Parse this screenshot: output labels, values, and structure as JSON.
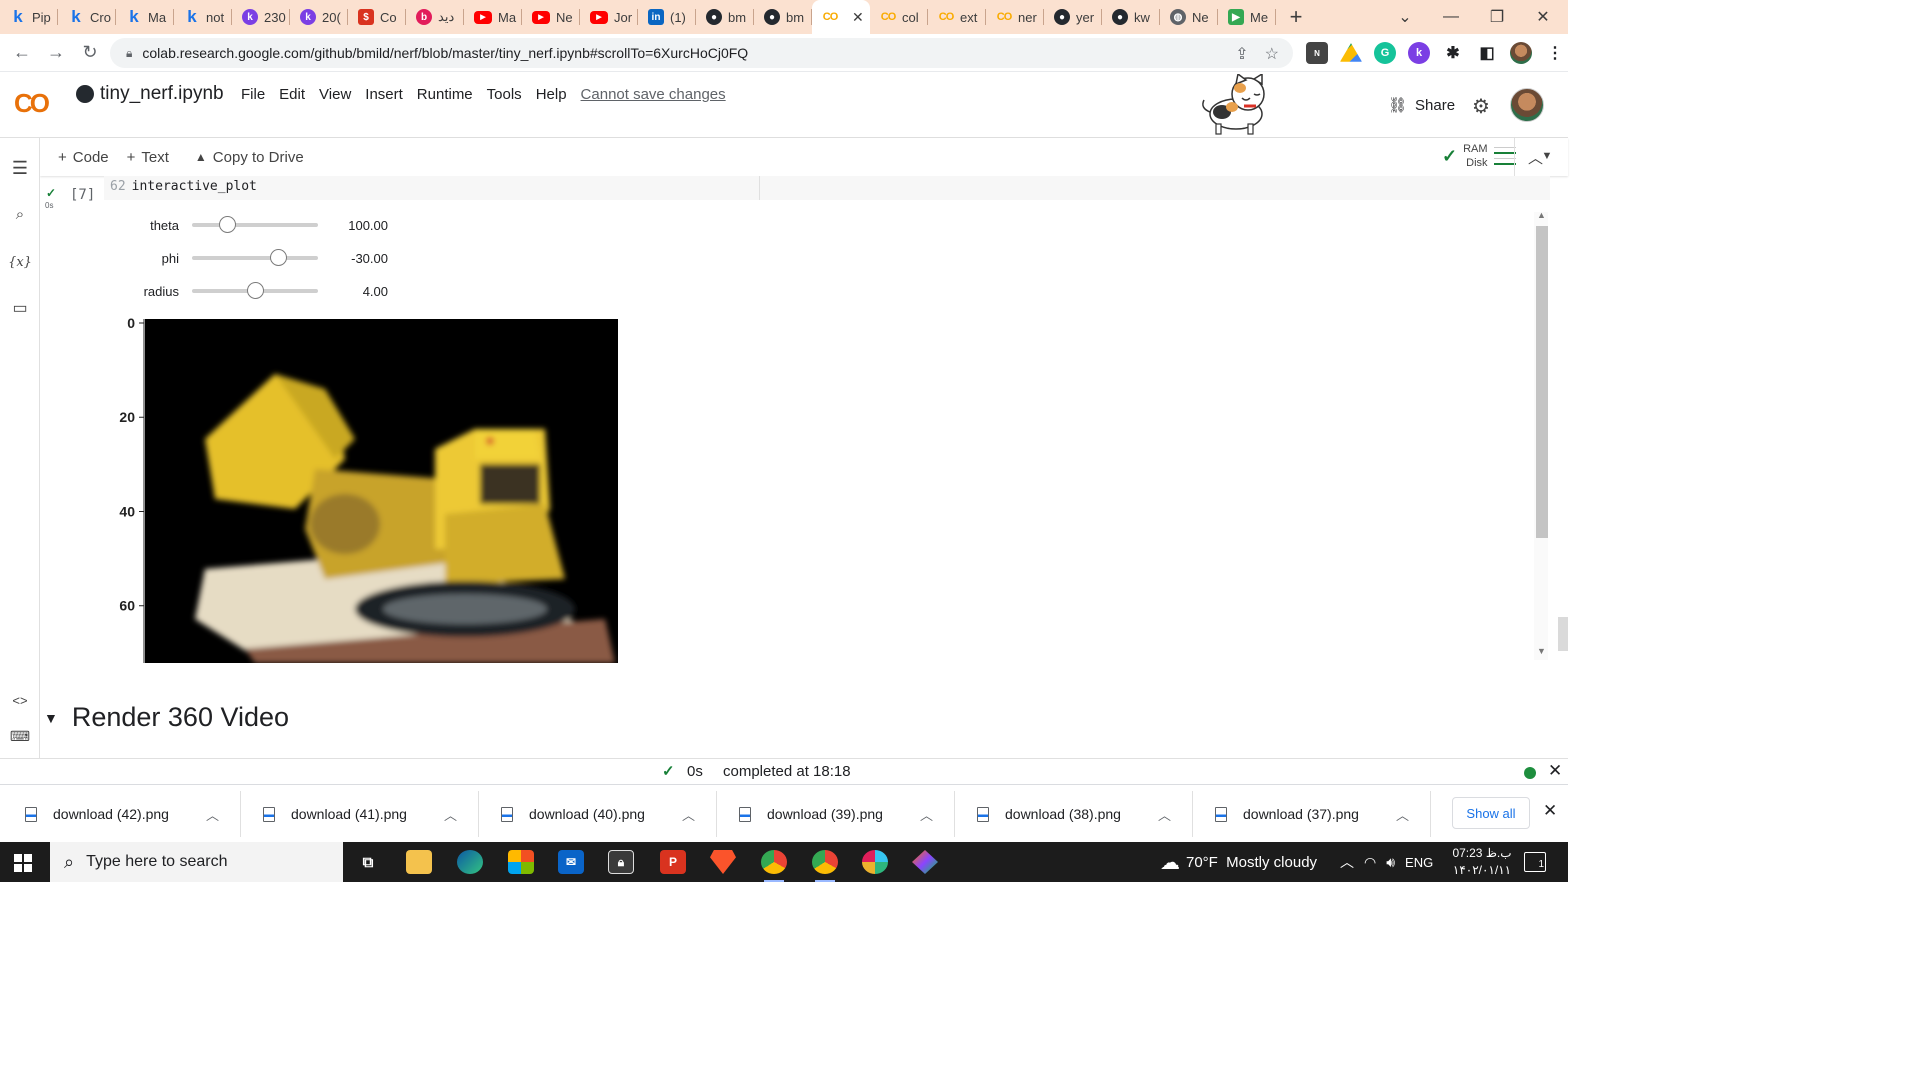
{
  "browser": {
    "tabs": [
      {
        "icon": "kaggle",
        "label": "Pip"
      },
      {
        "icon": "kaggle",
        "label": "Cro"
      },
      {
        "icon": "kaggle",
        "label": "Ma"
      },
      {
        "icon": "kaggle",
        "label": "not"
      },
      {
        "icon": "k-purple",
        "label": "230"
      },
      {
        "icon": "k-purple",
        "label": "20("
      },
      {
        "icon": "hub",
        "label": "Co"
      },
      {
        "icon": "b",
        "label": "دید"
      },
      {
        "icon": "youtube",
        "label": "Ma"
      },
      {
        "icon": "youtube",
        "label": "Ne"
      },
      {
        "icon": "youtube",
        "label": "Jor"
      },
      {
        "icon": "linkedin",
        "label": "(1)"
      },
      {
        "icon": "github",
        "label": "bm"
      },
      {
        "icon": "github",
        "label": "bm"
      },
      {
        "icon": "colab",
        "label": "",
        "active": true
      },
      {
        "icon": "colab",
        "label": "col"
      },
      {
        "icon": "colab",
        "label": "ext"
      },
      {
        "icon": "colab",
        "label": "ner"
      },
      {
        "icon": "github",
        "label": "yer"
      },
      {
        "icon": "github",
        "label": "kw"
      },
      {
        "icon": "globe",
        "label": "Ne"
      },
      {
        "icon": "meet",
        "label": "Me"
      }
    ],
    "new_tab": "+",
    "address": "colab.research.google.com/github/bmild/nerf/blob/master/tiny_nerf.ipynb#scrollTo=6XurcHoCj0FQ"
  },
  "colab": {
    "logo": "CO",
    "notebook_title": "tiny_nerf.ipynb",
    "menu": [
      "File",
      "Edit",
      "View",
      "Insert",
      "Runtime",
      "Tools",
      "Help"
    ],
    "cannot_save": "Cannot save changes",
    "share_label": "Share",
    "toolbar": {
      "code": "Code",
      "text": "Text",
      "copy_to_drive": "Copy to Drive"
    },
    "resources": {
      "ram": "RAM",
      "disk": "Disk"
    }
  },
  "cell": {
    "exec_count": "[7]",
    "exec_time": "0s",
    "line_number": "62",
    "code": "interactive_plot"
  },
  "sliders": [
    {
      "label": "theta",
      "value": "100.00",
      "fraction": 0.28
    },
    {
      "label": "phi",
      "value": "-30.00",
      "fraction": 0.68
    },
    {
      "label": "radius",
      "value": "4.00",
      "fraction": 0.5
    }
  ],
  "chart_data": {
    "type": "heatmap",
    "title": "",
    "y_ticks": [
      "0",
      "20",
      "40",
      "60"
    ],
    "y_tick_values": [
      0,
      20,
      40,
      60
    ],
    "ylim": [
      0,
      73
    ],
    "description": ""
  },
  "section": {
    "title": "Render 360 Video"
  },
  "status": {
    "elapsed": "0s",
    "completed": "completed at 18:18"
  },
  "downloads": {
    "items": [
      "download (42).png",
      "download (41).png",
      "download (40).png",
      "download (39).png",
      "download (38).png",
      "download (37).png"
    ],
    "show_all": "Show all"
  },
  "taskbar": {
    "search_placeholder": "Type here to search",
    "weather": "70°F  Mostly cloudy",
    "lang": "ENG",
    "time": "07:23 ب.ظ",
    "date": "۱۴۰۲/۰۱/۱۱",
    "notifications": "1"
  },
  "colors": {
    "tab_strip": "#fbe1d0",
    "colab_orange": "#f9ab00",
    "status_green": "#1e8e3e",
    "link_blue": "#1a73e8"
  }
}
